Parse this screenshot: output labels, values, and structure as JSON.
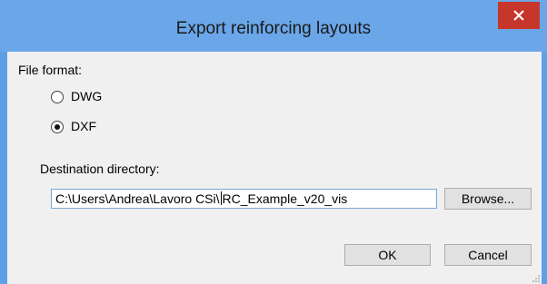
{
  "window": {
    "title": "Export reinforcing layouts"
  },
  "file_format": {
    "label": "File format:",
    "options": [
      {
        "label": "DWG",
        "selected": false
      },
      {
        "label": "DXF",
        "selected": true
      }
    ]
  },
  "destination": {
    "label": "Destination directory:",
    "value_before_caret": "C:\\Users\\Andrea\\Lavoro CSi\\",
    "value_after_caret": "RC_Example_v20_vis",
    "browse_label": "Browse..."
  },
  "buttons": {
    "ok_label": "OK",
    "cancel_label": "Cancel"
  },
  "colors": {
    "titlebar": "#6aa6e8",
    "close_button": "#c7362b",
    "client_background": "#f0f0f0",
    "input_border": "#7aa7d8"
  }
}
